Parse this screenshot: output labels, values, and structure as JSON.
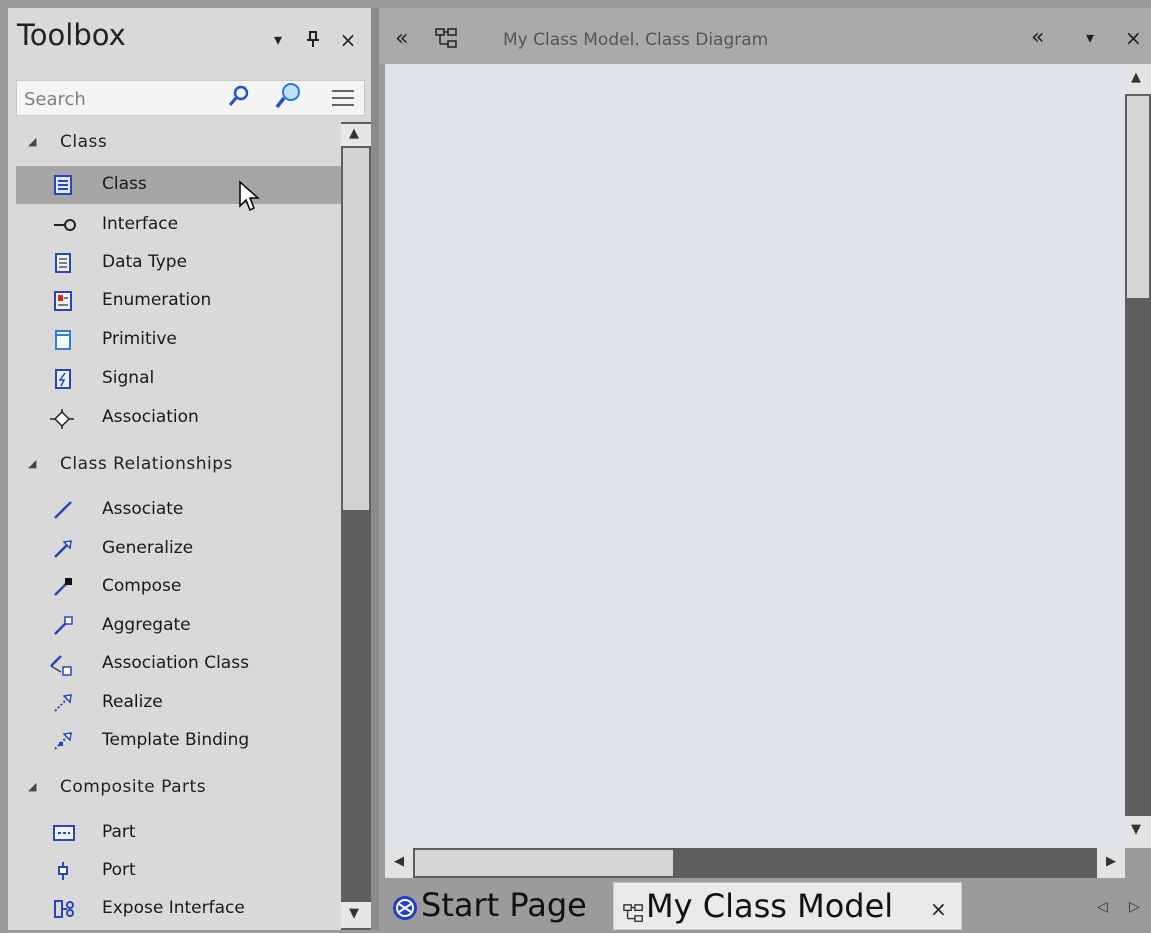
{
  "toolbox": {
    "title": "Toolbox",
    "menu_btn": "▾",
    "pin_btn": "ꟷ",
    "close_btn": "×",
    "search_placeholder": "Search",
    "groups": [
      {
        "label": "Class",
        "items": [
          "Class",
          "Interface",
          "Data Type",
          "Enumeration",
          "Primitive",
          "Signal",
          "Association"
        ]
      },
      {
        "label": "Class Relationships",
        "items": [
          "Associate",
          "Generalize",
          "Compose",
          "Aggregate",
          "Association Class",
          "Realize",
          "Template Binding"
        ]
      },
      {
        "label": "Composite Parts",
        "items": [
          "Part",
          "Port",
          "Expose Interface"
        ]
      }
    ],
    "selected_item": "Class"
  },
  "diagram": {
    "title": "My Class Model.  Class Diagram",
    "collapse_left": "«",
    "collapse_right": "«",
    "menu_btn": "▾",
    "close_btn": "×"
  },
  "tabs": {
    "start_page": "Start Page",
    "model_tab": "My Class Model",
    "model_close": "×",
    "nav_left": "◁",
    "nav_right": "▷"
  },
  "colors": {
    "canvas": "#e1e3ea",
    "panel": "#d9d9d9",
    "selected": "#a6a6a6",
    "accent": "#1f4fd8"
  }
}
